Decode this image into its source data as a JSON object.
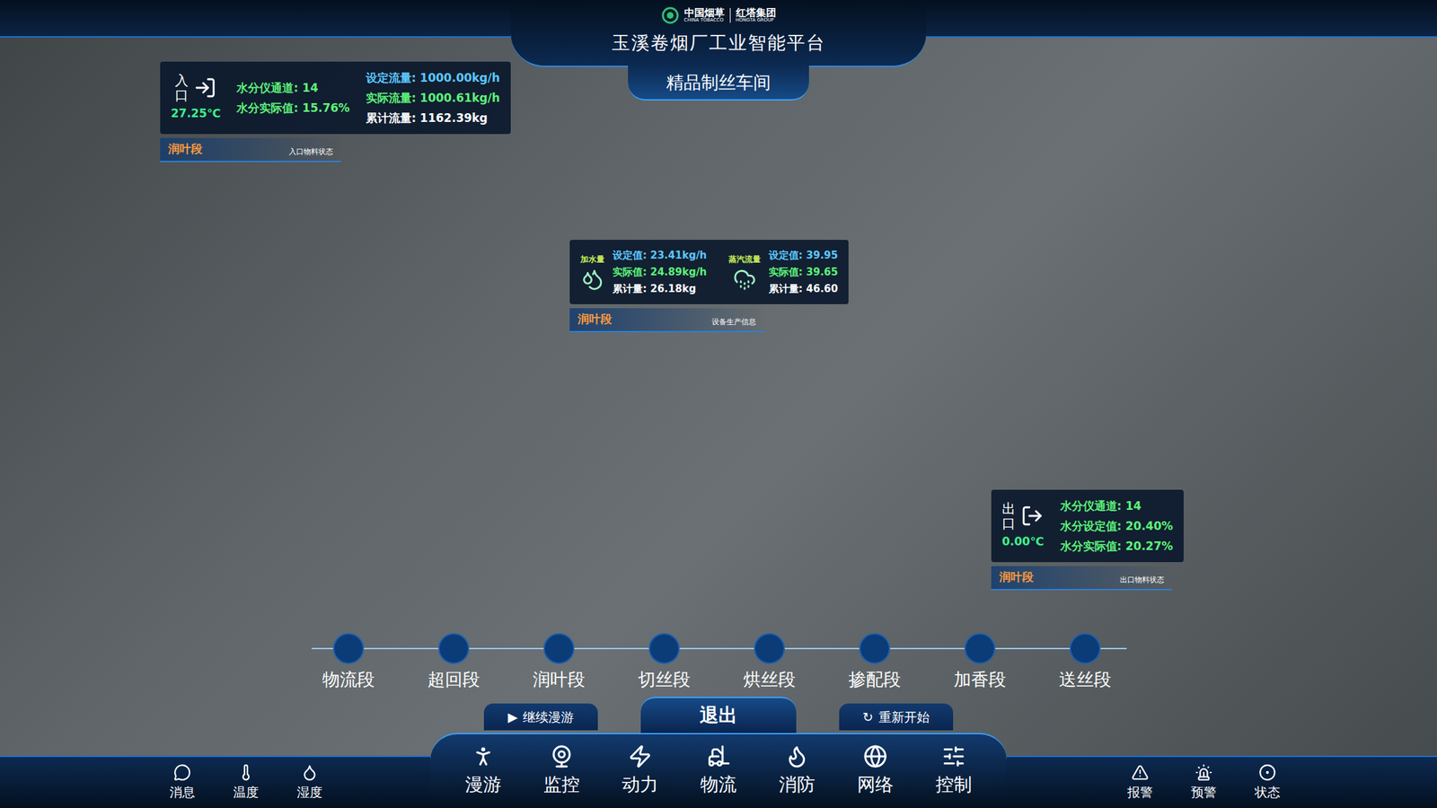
{
  "header": {
    "logo": {
      "brand_cn": "中国烟草",
      "brand_en": "CHINA TOBACCO",
      "group_cn": "红塔集团",
      "group_en": "HONGTA GROUP"
    },
    "title": "玉溪卷烟厂工业智能平台",
    "subtitle": "精品制丝车间"
  },
  "panels": [
    {
      "kind": "inlet",
      "direction": "入口",
      "temperature": "27.25℃",
      "section": "润叶段",
      "caption": "入口物料状态",
      "columns": [
        [
          {
            "text": "水分仪通道: 14",
            "color": "#5df27a"
          },
          {
            "text": "水分实际值: 15.76%",
            "color": "#5df27a"
          }
        ],
        [
          {
            "text": "设定流量: 1000.00kg/h",
            "color": "#5cc8ff"
          },
          {
            "text": "实际流量: 1000.61kg/h",
            "color": "#5df27a"
          },
          {
            "text": "累计流量: 1162.39kg",
            "color": "#ffffff"
          }
        ]
      ]
    },
    {
      "kind": "equipment",
      "section": "润叶段",
      "caption": "设备生产信息",
      "groups": [
        {
          "name": "加水量",
          "rows": [
            {
              "text": "设定值: 23.41kg/h",
              "color": "#5cc8ff"
            },
            {
              "text": "实际值: 24.89kg/h",
              "color": "#5df27a"
            },
            {
              "text": "累计量: 26.18kg",
              "color": "#ffffff"
            }
          ]
        },
        {
          "name": "蒸汽流量",
          "rows": [
            {
              "text": "设定值: 39.95",
              "color": "#5cc8ff"
            },
            {
              "text": "实际值: 39.65",
              "color": "#5df27a"
            },
            {
              "text": "累计量: 46.60",
              "color": "#ffffff"
            }
          ]
        }
      ]
    },
    {
      "kind": "outlet",
      "direction": "出口",
      "temperature": "0.00℃",
      "section": "润叶段",
      "caption": "出口物料状态",
      "columns": [
        [
          {
            "text": "水分仪通道: 14",
            "color": "#5df27a"
          },
          {
            "text": "水分设定值: 20.40%",
            "color": "#5df27a"
          },
          {
            "text": "水分实际值: 20.27%",
            "color": "#5df27a"
          }
        ]
      ]
    }
  ],
  "stages": [
    {
      "label": "物流段",
      "selected": false
    },
    {
      "label": "超回段",
      "selected": false
    },
    {
      "label": "润叶段",
      "selected": false
    },
    {
      "label": "切丝段",
      "selected": false
    },
    {
      "label": "烘丝段",
      "selected": false
    },
    {
      "label": "掺配段",
      "selected": false
    },
    {
      "label": "加香段",
      "selected": false
    },
    {
      "label": "送丝段",
      "selected": false
    }
  ],
  "actions": [
    {
      "kind": "side",
      "icon": "▶",
      "label": "继续漫游"
    },
    {
      "kind": "main",
      "icon": "",
      "label": "退出"
    },
    {
      "kind": "side",
      "icon": "↻",
      "label": "重新开始"
    }
  ],
  "nav": {
    "left": [
      {
        "label": "消息",
        "selected": false
      },
      {
        "label": "温度",
        "selected": false
      },
      {
        "label": "湿度",
        "selected": false
      }
    ],
    "center": [
      {
        "label": "漫游",
        "selected": false
      },
      {
        "label": "监控",
        "selected": false
      },
      {
        "label": "动力",
        "selected": false
      },
      {
        "label": "物流",
        "selected": false
      },
      {
        "label": "消防",
        "selected": false
      },
      {
        "label": "网络",
        "selected": false
      },
      {
        "label": "控制",
        "selected": false
      }
    ],
    "right": [
      {
        "label": "报警",
        "selected": false
      },
      {
        "label": "预警",
        "selected": false
      },
      {
        "label": "状态",
        "selected": false
      }
    ]
  }
}
